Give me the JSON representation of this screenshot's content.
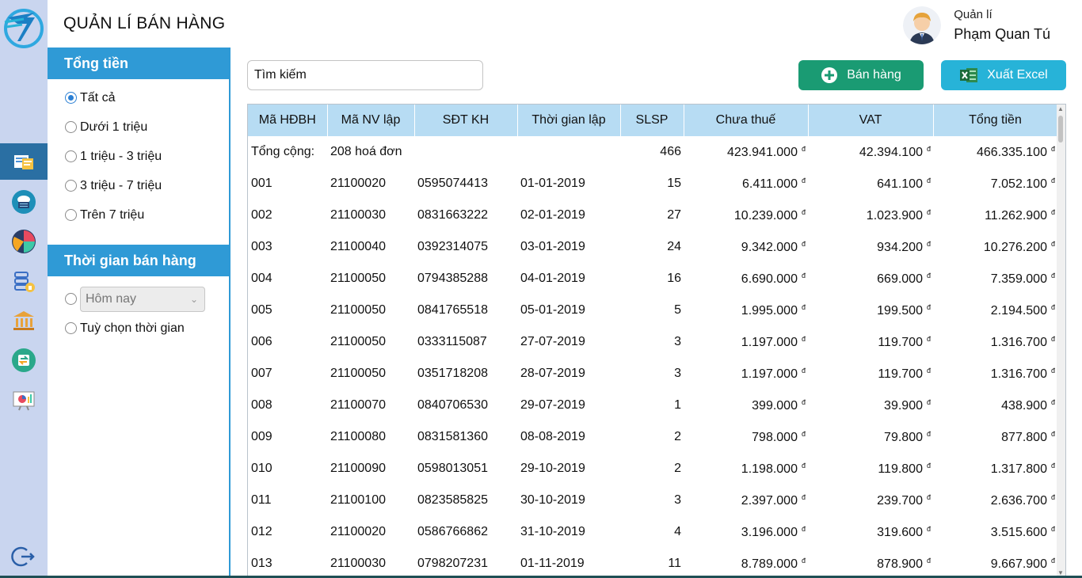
{
  "header": {
    "title": "QUẢN LÍ BÁN HÀNG"
  },
  "user": {
    "role": "Quản lí",
    "name": "Phạm Quan Tú"
  },
  "sidebar": {
    "items": [
      {
        "name": "invoice-list-icon",
        "active": true
      },
      {
        "name": "cloud-database-icon",
        "active": false
      },
      {
        "name": "pie-chart-icon",
        "active": false
      },
      {
        "name": "database-lock-icon",
        "active": false
      },
      {
        "name": "bank-icon",
        "active": false
      },
      {
        "name": "transfer-icon",
        "active": false
      },
      {
        "name": "presentation-chart-icon",
        "active": false
      }
    ],
    "logout_icon": "logout-icon"
  },
  "filters": {
    "total_section": {
      "title": "Tổng tiền",
      "options": [
        {
          "label": "Tất cả",
          "checked": true
        },
        {
          "label": "Dưới 1 triệu",
          "checked": false
        },
        {
          "label": "1 triệu - 3 triệu",
          "checked": false
        },
        {
          "label": "3 triệu - 7 triệu",
          "checked": false
        },
        {
          "label": "Trên 7 triệu",
          "checked": false
        }
      ]
    },
    "time_section": {
      "title": "Thời gian bán hàng",
      "preset_select_value": "Hôm nay",
      "custom_label": "Tuỳ chọn thời gian"
    }
  },
  "search": {
    "placeholder": "Tìm kiếm"
  },
  "actions": {
    "sell_label": "Bán hàng",
    "export_label": "Xuất Excel"
  },
  "colors": {
    "primary_blue": "#2f9ad6",
    "sell_green": "#1a9b73",
    "excel_cyan": "#27b3d8",
    "header_blue": "#b7dcf3",
    "rail_bg": "#c9d5ef",
    "active_rail": "#2a6fa3"
  },
  "table": {
    "currency_symbol": "đ",
    "columns": [
      "Mã HĐBH",
      "Mã NV lập",
      "SĐT KH",
      "Thời gian lập",
      "SLSP",
      "Chưa thuế",
      "VAT",
      "Tổng tiền"
    ],
    "totals": {
      "label": "Tổng cộng:",
      "count": "208 hoá đơn",
      "qty": "466",
      "subtotal": "423.941.000",
      "vat": "42.394.100",
      "total": "466.335.100"
    },
    "rows": [
      {
        "id": "001",
        "staff": "21100020",
        "phone": "0595074413",
        "date": "01-01-2019",
        "qty": "15",
        "subtotal": "6.411.000",
        "vat": "641.100",
        "total": "7.052.100"
      },
      {
        "id": "002",
        "staff": "21100030",
        "phone": "0831663222",
        "date": "02-01-2019",
        "qty": "27",
        "subtotal": "10.239.000",
        "vat": "1.023.900",
        "total": "11.262.900"
      },
      {
        "id": "003",
        "staff": "21100040",
        "phone": "0392314075",
        "date": "03-01-2019",
        "qty": "24",
        "subtotal": "9.342.000",
        "vat": "934.200",
        "total": "10.276.200"
      },
      {
        "id": "004",
        "staff": "21100050",
        "phone": "0794385288",
        "date": "04-01-2019",
        "qty": "16",
        "subtotal": "6.690.000",
        "vat": "669.000",
        "total": "7.359.000"
      },
      {
        "id": "005",
        "staff": "21100050",
        "phone": "0841765518",
        "date": "05-01-2019",
        "qty": "5",
        "subtotal": "1.995.000",
        "vat": "199.500",
        "total": "2.194.500"
      },
      {
        "id": "006",
        "staff": "21100050",
        "phone": "0333115087",
        "date": "27-07-2019",
        "qty": "3",
        "subtotal": "1.197.000",
        "vat": "119.700",
        "total": "1.316.700"
      },
      {
        "id": "007",
        "staff": "21100050",
        "phone": "0351718208",
        "date": "28-07-2019",
        "qty": "3",
        "subtotal": "1.197.000",
        "vat": "119.700",
        "total": "1.316.700"
      },
      {
        "id": "008",
        "staff": "21100070",
        "phone": "0840706530",
        "date": "29-07-2019",
        "qty": "1",
        "subtotal": "399.000",
        "vat": "39.900",
        "total": "438.900"
      },
      {
        "id": "009",
        "staff": "21100080",
        "phone": "0831581360",
        "date": "08-08-2019",
        "qty": "2",
        "subtotal": "798.000",
        "vat": "79.800",
        "total": "877.800"
      },
      {
        "id": "010",
        "staff": "21100090",
        "phone": "0598013051",
        "date": "29-10-2019",
        "qty": "2",
        "subtotal": "1.198.000",
        "vat": "119.800",
        "total": "1.317.800"
      },
      {
        "id": "011",
        "staff": "21100100",
        "phone": "0823585825",
        "date": "30-10-2019",
        "qty": "3",
        "subtotal": "2.397.000",
        "vat": "239.700",
        "total": "2.636.700"
      },
      {
        "id": "012",
        "staff": "21100020",
        "phone": "0586766862",
        "date": "31-10-2019",
        "qty": "4",
        "subtotal": "3.196.000",
        "vat": "319.600",
        "total": "3.515.600"
      },
      {
        "id": "013",
        "staff": "21100030",
        "phone": "0798207231",
        "date": "01-11-2019",
        "qty": "11",
        "subtotal": "8.789.000",
        "vat": "878.900",
        "total": "9.667.900"
      }
    ]
  }
}
